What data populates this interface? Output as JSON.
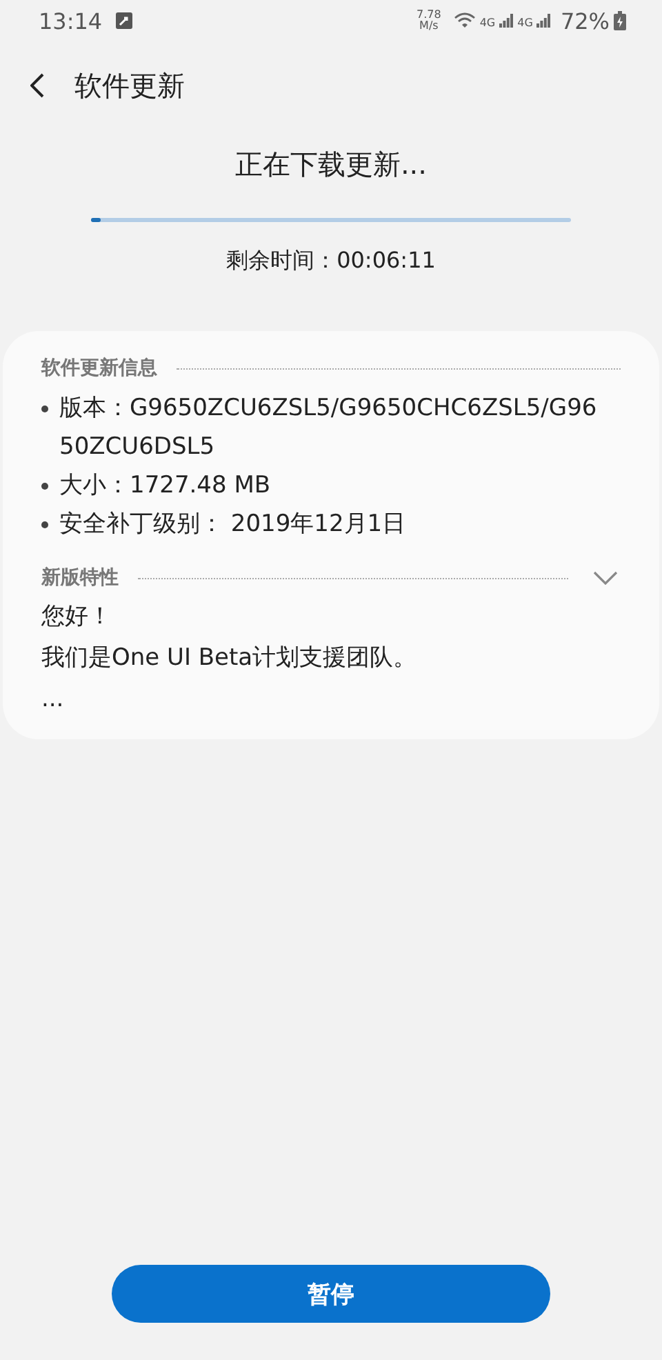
{
  "status_bar": {
    "time": "13:14",
    "speed_value": "7.78",
    "speed_unit": "M/s",
    "network_1": "4G",
    "network_2": "4G",
    "battery": "72%"
  },
  "header": {
    "title": "软件更新"
  },
  "download": {
    "title": "正在下载更新...",
    "level": 0.02,
    "remaining": "剩余时间：00:06:11"
  },
  "info": {
    "heading": "软件更新信息",
    "items": [
      {
        "text": "版本：G9650ZCU6ZSL5/G9650CHC6ZSL5/G9650ZCU6DSL5"
      },
      {
        "text": "大小：1727.48 MB"
      },
      {
        "text": "安全补丁级别： 2019年12月1日"
      }
    ],
    "features_heading": "新版特性",
    "features_lines": [
      "您好！",
      "我们是One UI Beta计划支援团队。",
      "..."
    ]
  },
  "button": {
    "label": "暂停"
  }
}
